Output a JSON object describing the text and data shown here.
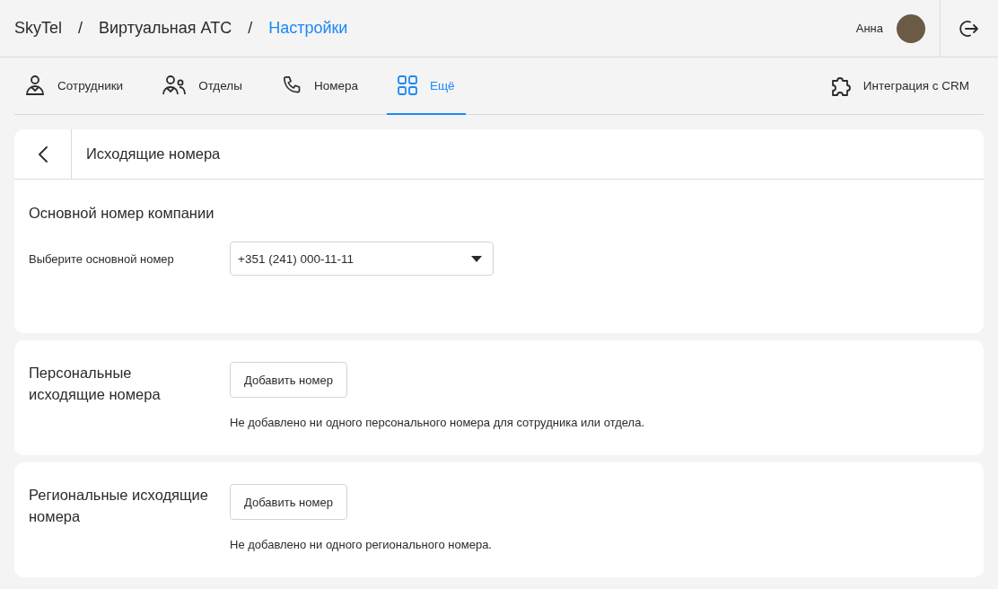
{
  "breadcrumbs": [
    {
      "label": "SkyTel",
      "selected": false
    },
    {
      "label": "Виртуальная АТС",
      "selected": false
    },
    {
      "label": "Настройки",
      "selected": true
    }
  ],
  "breadcrumb_separators": [
    "/",
    "/"
  ],
  "user": {
    "name": "Анна"
  },
  "tabs": [
    {
      "label": "Сотрудники",
      "kind": "person",
      "selected": false
    },
    {
      "label": "Отделы",
      "kind": "people",
      "selected": false
    },
    {
      "label": "Номера",
      "kind": "phone",
      "selected": false
    },
    {
      "label": "Ещё",
      "kind": "grid",
      "selected": true
    }
  ],
  "integration": {
    "label": "Интеграция с CRM"
  },
  "page": {
    "title": "Исходящие номера"
  },
  "main_number": {
    "heading": "Основной номер компании",
    "label": "Выберите основной номер",
    "value": "+351 (241) 000-11-11"
  },
  "sections": [
    {
      "title": "Персональные исходящие номера",
      "button": "Добавить номер",
      "empty_text": "Не добавлено ни одного персонального номера для сотрудника или отдела."
    },
    {
      "title": "Региональные исходящие номера",
      "button": "Добавить номер",
      "empty_text": "Не добавлено ни одного регионального номера."
    }
  ]
}
